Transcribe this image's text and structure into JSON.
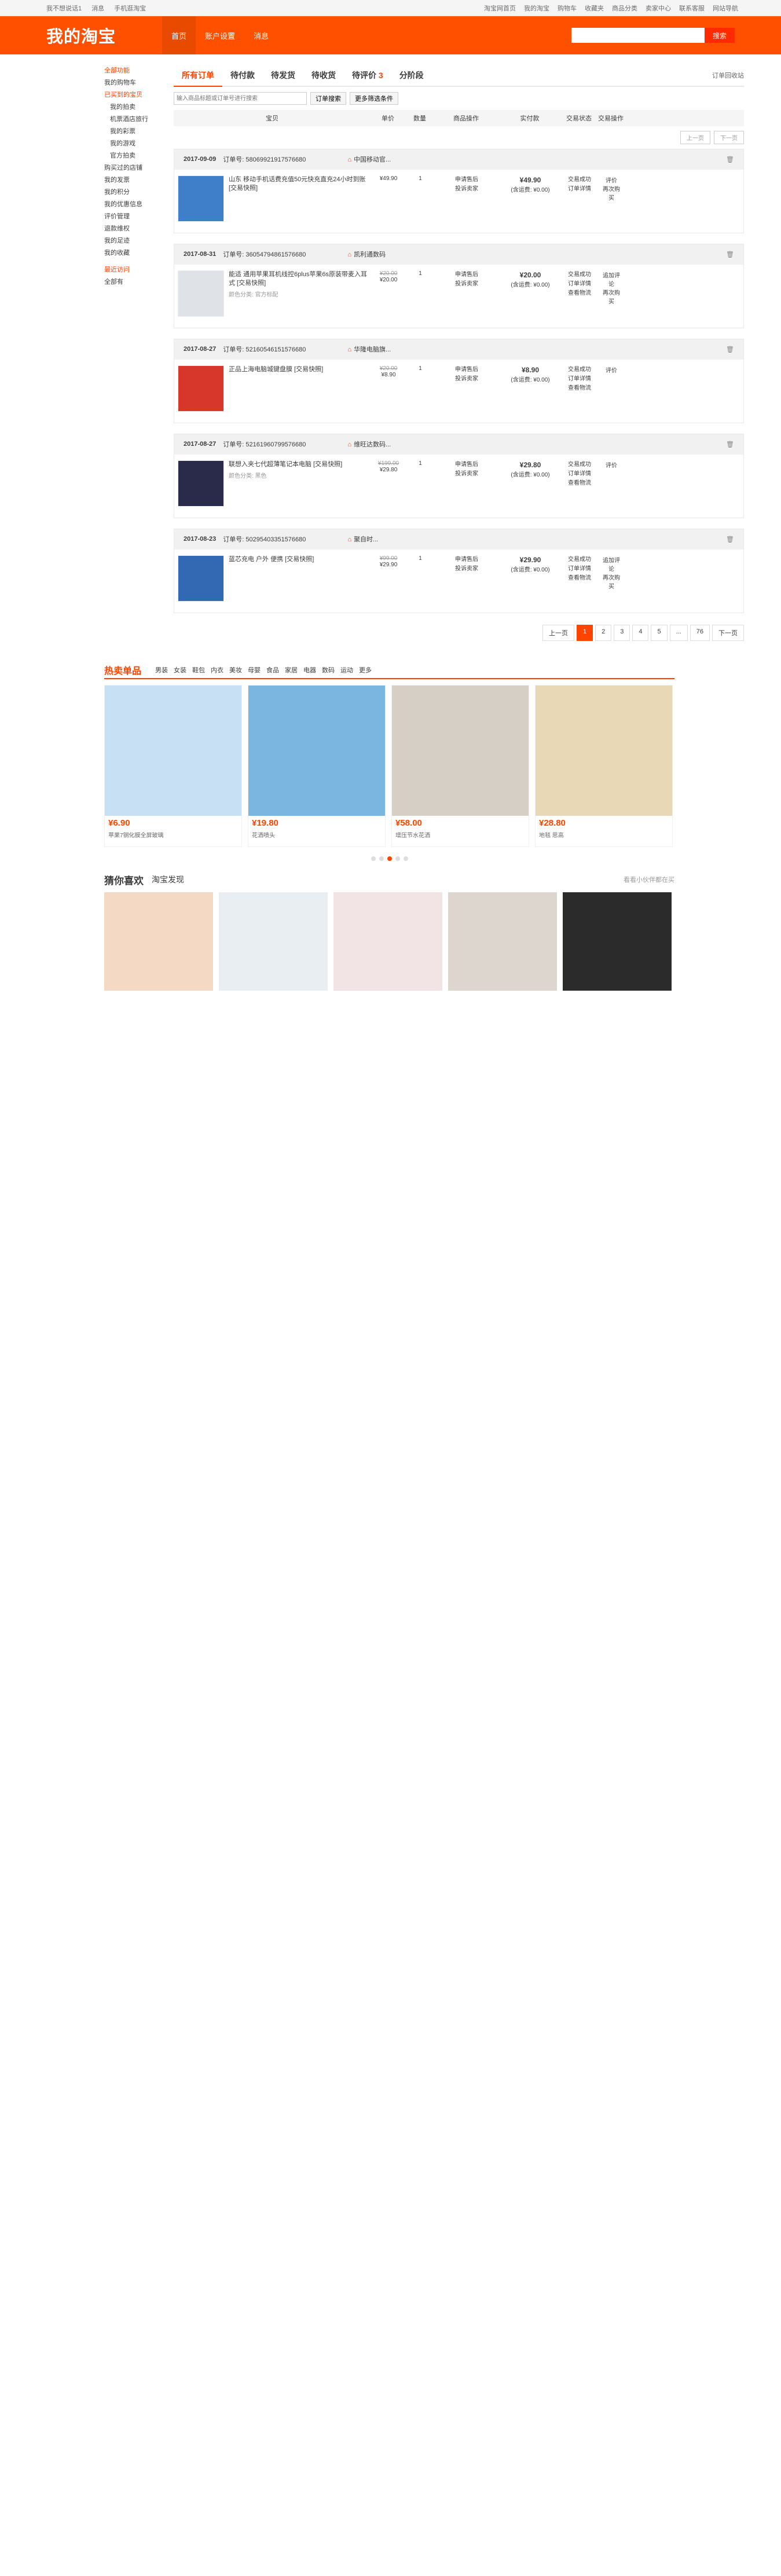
{
  "topbar": {
    "left": [
      "我不想说话1",
      "消息",
      "手机逛淘宝"
    ],
    "right": [
      "淘宝网首页",
      "我的淘宝",
      "购物车",
      "收藏夹",
      "商品分类",
      "卖家中心",
      "联系客服",
      "网站导航"
    ]
  },
  "header": {
    "logo": "我的淘宝",
    "nav": [
      "首页",
      "账户设置",
      "消息"
    ],
    "search_placeholder": "",
    "search_button": "搜索"
  },
  "sidebar": {
    "items": [
      "全部功能",
      "我的购物车",
      "已买到的宝贝",
      "我的拍卖",
      "机票酒店旅行",
      "我的彩票",
      "我的游戏",
      "官方拍卖",
      "购买过的店铺",
      "我的发票",
      "我的积分",
      "我的优惠信息",
      "评价管理",
      "退款维权",
      "我的足迹",
      "我的收藏",
      "最近访问",
      "全部有"
    ]
  },
  "tabs": {
    "items": [
      "所有订单",
      "待付款",
      "待发货",
      "待收货",
      "待评价",
      "分阶段"
    ],
    "pending_count": "3",
    "trash": "订单回收站"
  },
  "filter": {
    "placeholder": "输入商品标题或订单号进行搜索",
    "search_button": "订单搜索",
    "more": "更多筛选条件"
  },
  "table_head": [
    "宝贝",
    "单价",
    "数量",
    "商品操作",
    "实付款",
    "交易状态",
    "交易操作"
  ],
  "pager_small": [
    "上一页",
    "下一页"
  ],
  "orders": [
    {
      "date": "2017-09-09",
      "id": "订单号: 58069921917576680",
      "shop": "中国移动官...",
      "title": "山东 移动手机话费充值50元快充直充24小时到账 [交易快照]",
      "spec": "",
      "price_old": "",
      "price": "¥49.90",
      "qty": "1",
      "ops": "申请售后\n投诉卖家",
      "total": "¥49.90",
      "total_note": "(含运费: ¥0.00)",
      "status": "交易成功\n订单详情",
      "action": "评价\n再次购买"
    },
    {
      "date": "2017-08-31",
      "id": "订单号: 36054794861576680",
      "shop": "凯利通数码",
      "title": "能适 通用苹果耳机线控6plus苹果6s原装带麦入耳式 [交易快照]",
      "spec": "颜色分类: 官方标配",
      "price_old": "¥20.00",
      "price": "¥20.00",
      "qty": "1",
      "ops": "申请售后\n投诉卖家",
      "total": "¥20.00",
      "total_note": "(含运费: ¥0.00)",
      "status": "交易成功\n订单详情\n查看物流",
      "action": "追加评论\n再次购买"
    },
    {
      "date": "2017-08-27",
      "id": "订单号: 52160546151576680",
      "shop": "华隆电脑旗...",
      "title": "正品上海电脑城键盘膜 [交易快照]",
      "spec": "",
      "price_old": "¥20.00",
      "price": "¥8.90",
      "qty": "1",
      "ops": "申请售后\n投诉卖家",
      "total": "¥8.90",
      "total_note": "(含运费: ¥0.00)",
      "status": "交易成功\n订单详情\n查看物流",
      "action": "评价"
    },
    {
      "date": "2017-08-27",
      "id": "订单号: 52161960799576680",
      "shop": "维旺达数码...",
      "title": "联想入夹七代超薄笔记本电脑 [交易快照]",
      "spec": "颜色分类: 黑色",
      "price_old": "¥199.00",
      "price": "¥29.80",
      "qty": "1",
      "ops": "申请售后\n投诉卖家",
      "total": "¥29.80",
      "total_note": "(含运费: ¥0.00)",
      "status": "交易成功\n订单详情\n查看物流",
      "action": "评价"
    },
    {
      "date": "2017-08-23",
      "id": "订单号: 50295403351576680",
      "shop": "聚自时...",
      "title": "蓝芯充电 户外 便携 [交易快照]",
      "spec": "",
      "price_old": "¥99.00",
      "price": "¥29.90",
      "qty": "1",
      "ops": "申请售后\n投诉卖家",
      "total": "¥29.90",
      "total_note": "(含运费: ¥0.00)",
      "status": "交易成功\n订单详情\n查看物流",
      "action": "追加评论\n再次购买"
    }
  ],
  "pages": {
    "items": [
      "上一页",
      "1",
      "2",
      "3",
      "4",
      "5",
      "...",
      "76",
      "下一页"
    ]
  },
  "hot": {
    "title": "热卖单品",
    "tabs": [
      "男装",
      "女装",
      "鞋包",
      "内衣",
      "美妆",
      "母婴",
      "食品",
      "家居",
      "电器",
      "数码",
      "运动",
      "更多"
    ],
    "cards": [
      {
        "price": "¥6.90",
        "desc": "苹果7钢化膜全屏玻璃"
      },
      {
        "price": "¥19.80",
        "desc": "花洒喷头"
      },
      {
        "price": "¥58.00",
        "desc": "增压节水花洒"
      },
      {
        "price": "¥28.80",
        "desc": "地毯 思高"
      }
    ],
    "colors": [
      "#c8e0f4",
      "#7bb6e0",
      "#d6cfc6",
      "#e9d8b6"
    ]
  },
  "guess": {
    "title": "猜你喜欢",
    "sub": "淘宝发现",
    "right": "看看小伙伴都在买"
  }
}
